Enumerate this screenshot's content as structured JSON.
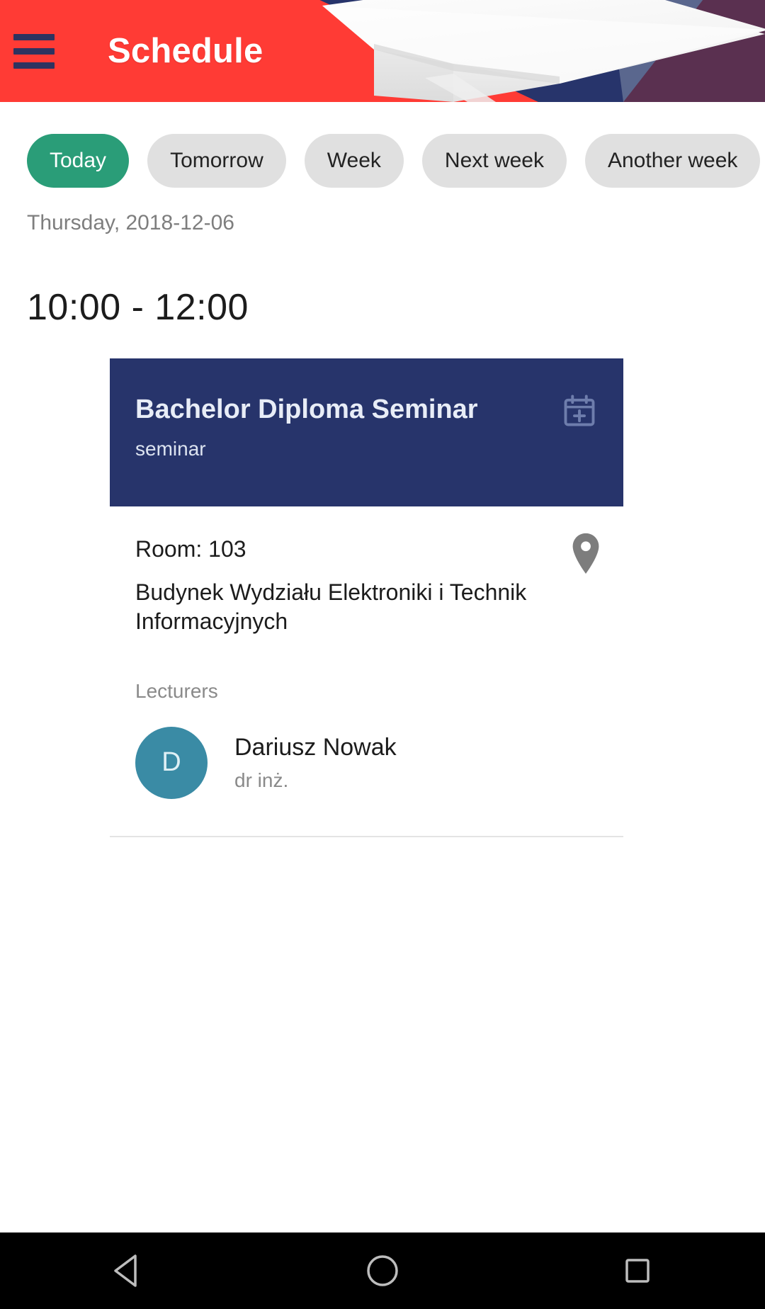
{
  "appbar": {
    "title": "Schedule",
    "menu_icon": "hamburger-menu-icon",
    "background_color": "#FF3B35",
    "accent_navy": "#27346B",
    "accent_plum": "#5A3050"
  },
  "chips": [
    {
      "label": "Today",
      "selected": true
    },
    {
      "label": "Tomorrow",
      "selected": false
    },
    {
      "label": "Week",
      "selected": false
    },
    {
      "label": "Next week",
      "selected": false
    },
    {
      "label": "Another week",
      "selected": false
    }
  ],
  "chip_colors": {
    "selected_bg": "#2A9D78",
    "selected_text": "#FFFFFF",
    "default_bg": "#E0E0E0",
    "default_text": "#232323"
  },
  "date_label": "Thursday, 2018-12-06",
  "event": {
    "time_range": "10:00 - 12:00",
    "title": "Bachelor Diploma Seminar",
    "subtitle": "seminar",
    "card_color": "#27346B",
    "add_calendar_icon": "calendar-add-icon",
    "room": "Room: 103",
    "building": "Budynek Wydziału Elektroniki i Technik Informacyjnych",
    "map_pin_icon": "map-pin-icon",
    "lecturers_label": "Lecturers",
    "lecturers": [
      {
        "initial": "D",
        "name": "Dariusz Nowak",
        "title": "dr inż.",
        "avatar_color": "#3A8BA5"
      }
    ]
  },
  "navbar": {
    "back_icon": "back-triangle-icon",
    "home_icon": "home-circle-icon",
    "recents_icon": "recents-square-icon"
  }
}
